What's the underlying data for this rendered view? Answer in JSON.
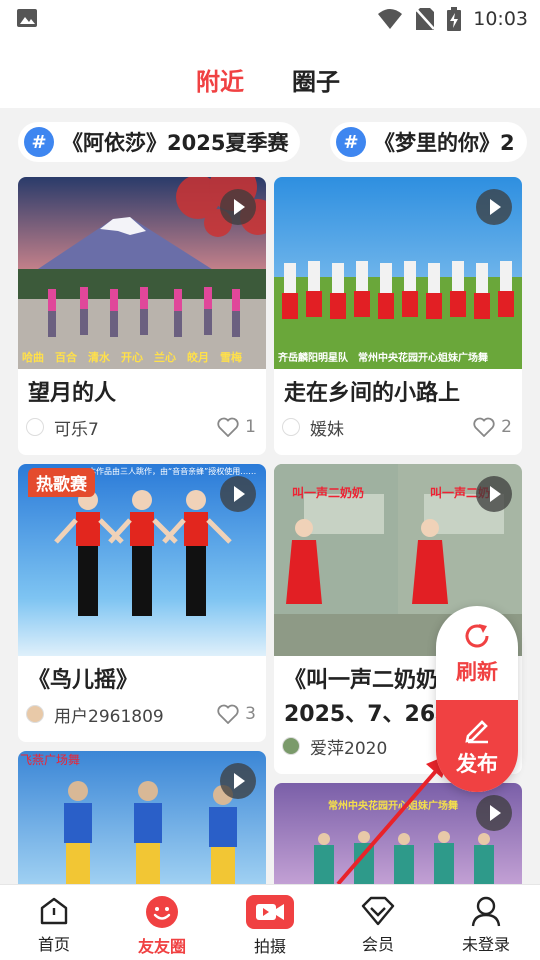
{
  "status_bar": {
    "time": "10:03"
  },
  "header": {
    "tabs": [
      {
        "label": "附近",
        "active": true
      },
      {
        "label": "圈子",
        "active": false
      }
    ]
  },
  "topics": [
    {
      "label": "《阿依莎》2025夏季赛"
    },
    {
      "label": "《梦里的你》2"
    }
  ],
  "cards": [
    {
      "title": "望月的人",
      "author": "可乐7",
      "likes": "1",
      "overlay": "哈曲　百合　清水　开心　兰心　皎月　雪梅"
    },
    {
      "title": "走在乡间的小路上",
      "author": "媛妹",
      "likes": "2",
      "overlay": "齐岳麟阳明星队　常州中央花园开心姐妹广场舞"
    },
    {
      "title": "《鸟儿摇》",
      "author": "用户2961809",
      "likes": "3",
      "badge": "热歌赛",
      "overlay": "本作品由三人跳作，由“音音亲蜂”授权使用……"
    },
    {
      "title_line1": "《叫一声二奶奶",
      "title_line2": "2025、7、26、",
      "author": "爱萍2020",
      "overlay_left": "叫一声二奶奶",
      "overlay_right": "叫一声二奶"
    },
    {
      "overlay": "飞燕广场舞"
    },
    {
      "overlay": "常州中央花园开心姐妹广场舞"
    }
  ],
  "fab": {
    "refresh_label": "刷新",
    "publish_label": "发布"
  },
  "bottom_nav": [
    {
      "label": "首页",
      "icon": "home-icon",
      "active": false
    },
    {
      "label": "友友圈",
      "icon": "smile-icon",
      "active": true
    },
    {
      "label": "拍摄",
      "icon": "camera-play-icon",
      "active": false
    },
    {
      "label": "会员",
      "icon": "diamond-icon",
      "active": false
    },
    {
      "label": "未登录",
      "icon": "user-icon",
      "active": false
    }
  ],
  "colors": {
    "accent": "#f04142",
    "topic_blue": "#3e86f0"
  }
}
